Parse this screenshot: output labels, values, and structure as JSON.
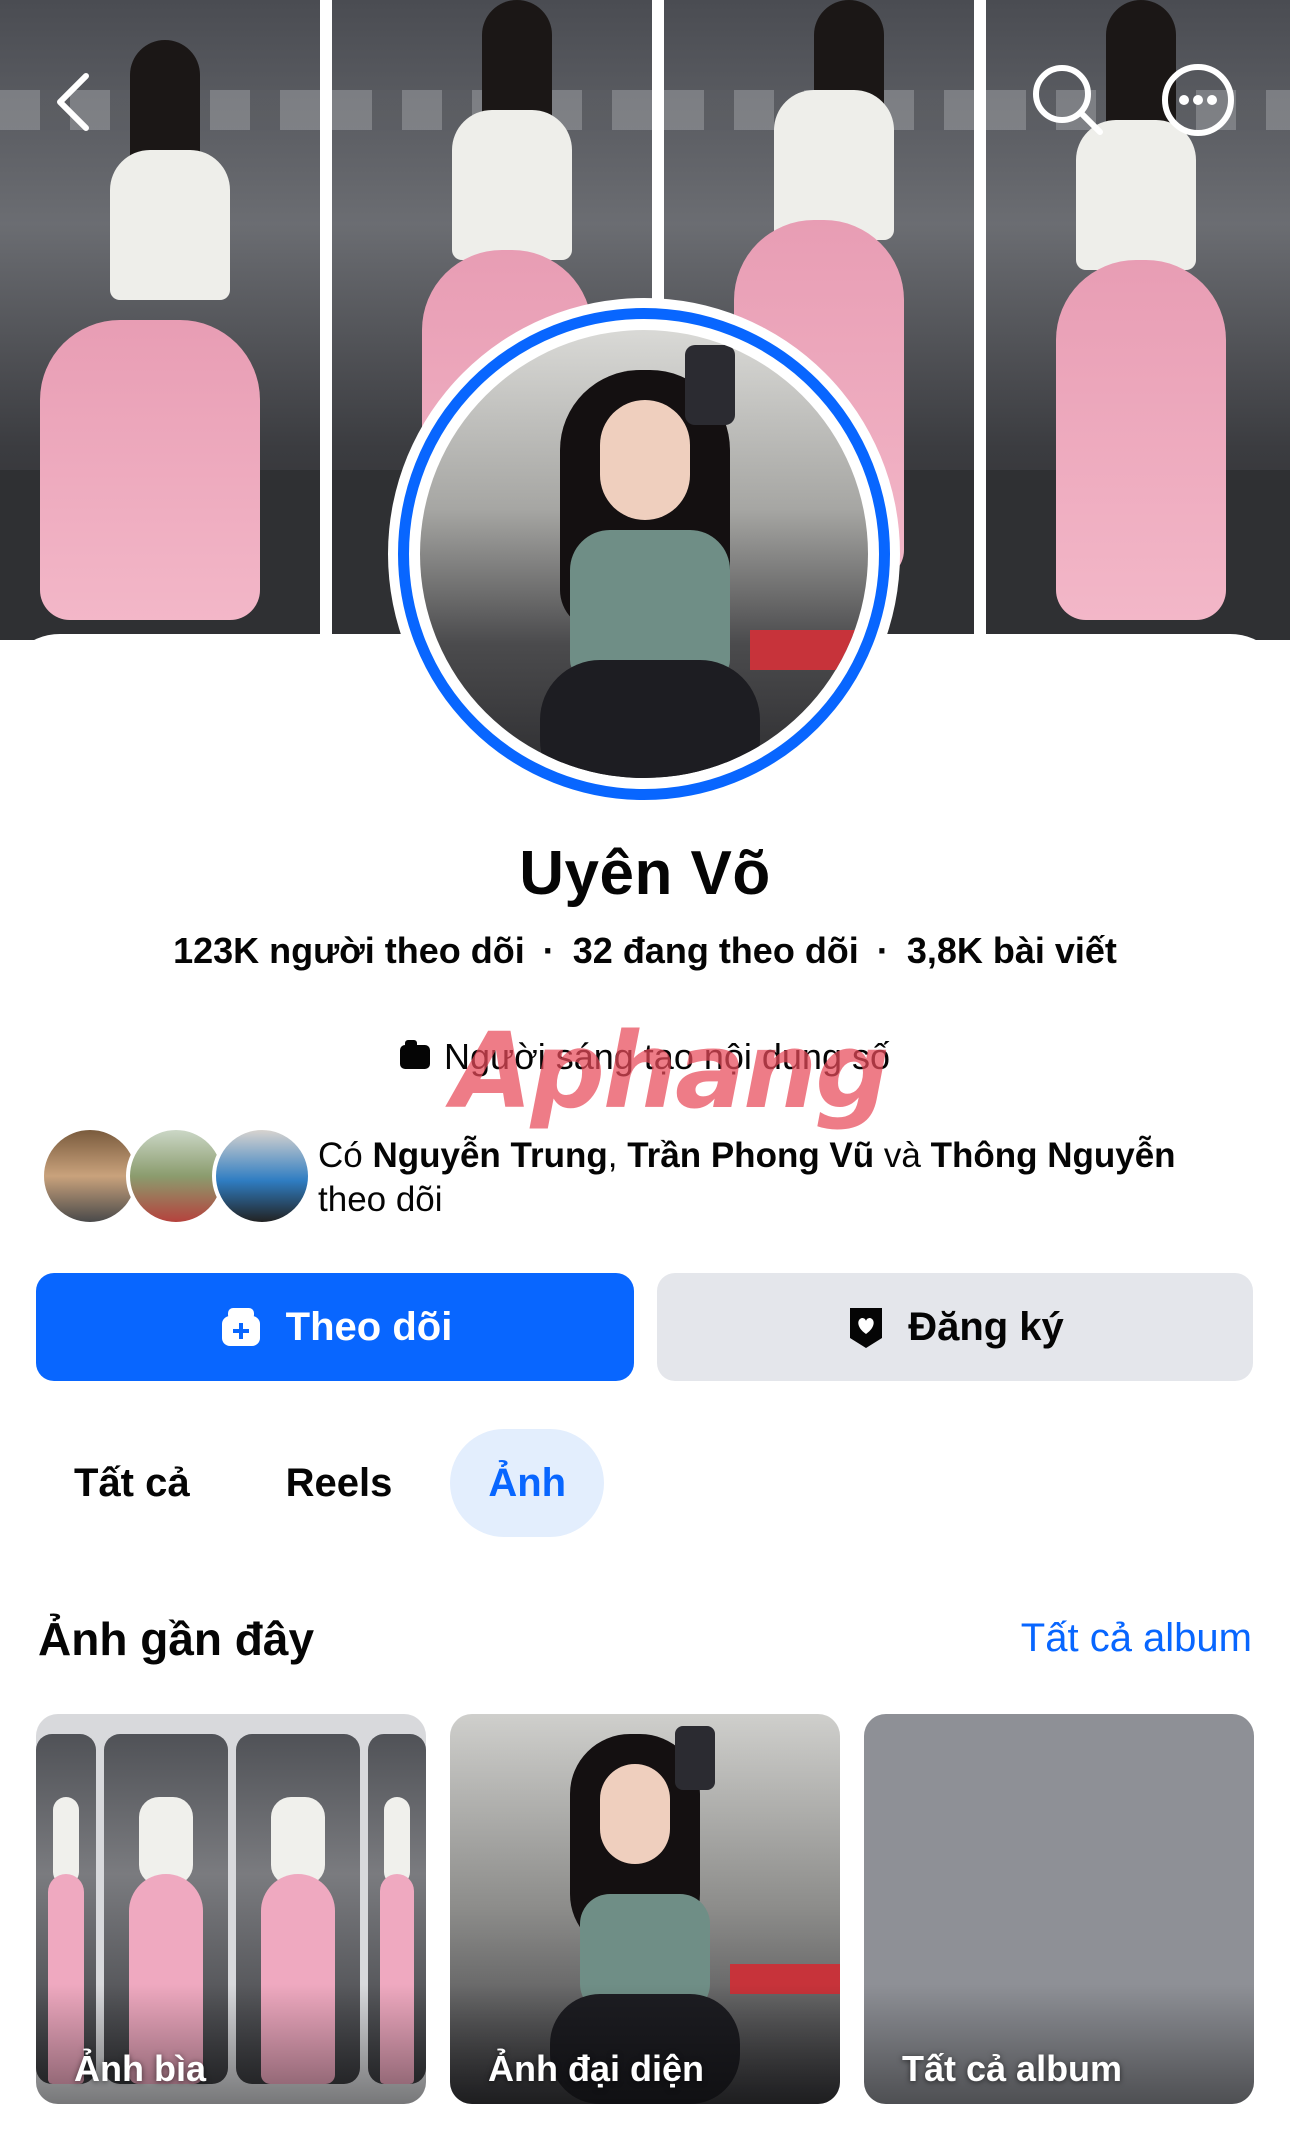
{
  "nav": {
    "back_icon": "back-chevron-icon",
    "search_icon": "search-icon",
    "more_icon": "more-options-icon"
  },
  "profile": {
    "name": "Uyên Võ",
    "followers": "123K người theo dõi",
    "following": "32 đang theo dõi",
    "posts": "3,8K bài viết",
    "separator": "·",
    "category": "Người sáng tạo nội dung số",
    "watermark": "Aphang"
  },
  "mutual": {
    "prefix": "Có ",
    "friend1": "Nguyễn Trung",
    "comma": ", ",
    "friend2": "Trần Phong Vũ",
    "and": " và ",
    "friend3": "Thông Nguyễn",
    "suffix": "theo dõi"
  },
  "actions": {
    "follow_label": "Theo dõi",
    "subscribe_label": "Đăng ký"
  },
  "tabs": [
    {
      "label": "Tất cả",
      "active": false
    },
    {
      "label": "Reels",
      "active": false
    },
    {
      "label": "Ảnh",
      "active": true
    }
  ],
  "recent_photos": {
    "title": "Ảnh gần đây",
    "link": "Tất cả album",
    "tiles": [
      {
        "label": "Ảnh bìa"
      },
      {
        "label": "Ảnh đại diện"
      },
      {
        "label": "Tất cả album"
      }
    ]
  },
  "colors": {
    "accent": "#0866ff",
    "button_secondary": "#e4e6eb",
    "tab_active_bg": "#e3eefd",
    "text": "#050505"
  }
}
